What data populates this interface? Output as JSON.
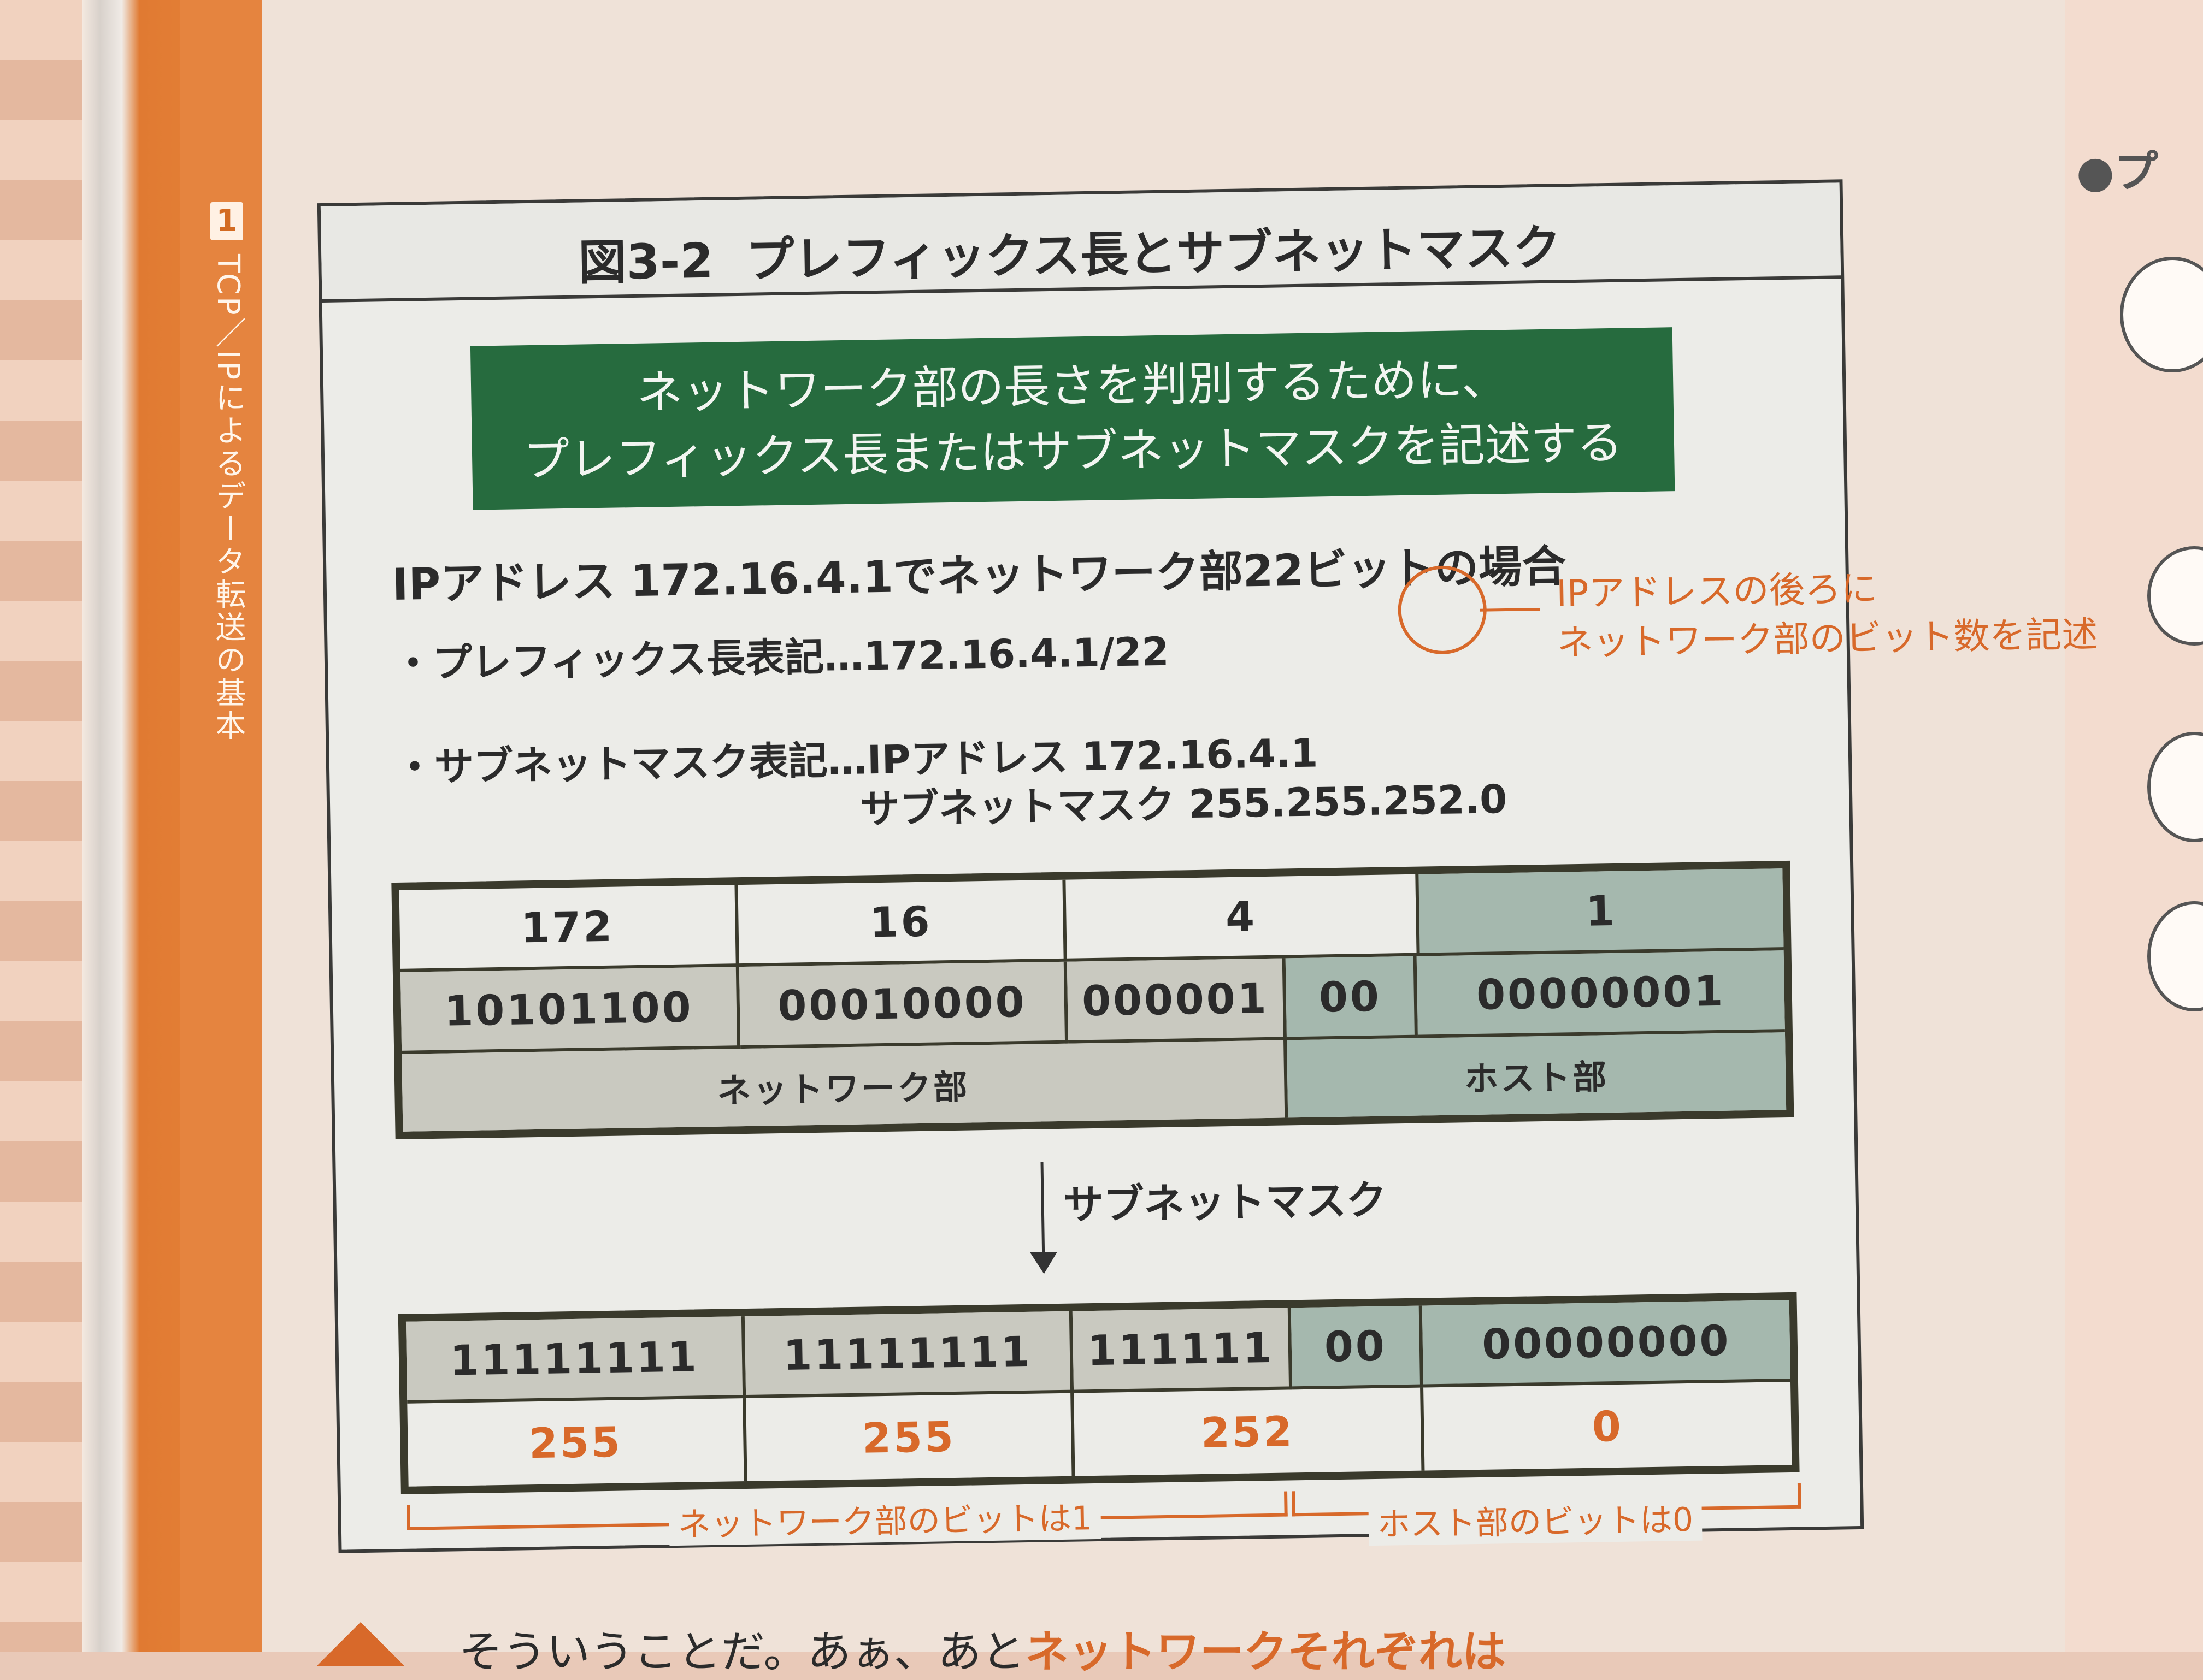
{
  "sidebar": {
    "chapter_number": "1",
    "chapter_title": "TCP／IPによるデータ転送の基本"
  },
  "right_page": {
    "heading": "●プ"
  },
  "figure": {
    "number": "図3-2",
    "title": "プレフィックス長とサブネットマスク",
    "banner_line1": "ネットワーク部の長さを判別するために、",
    "banner_line2": "プレフィックス長またはサブネットマスクを記述する",
    "case_text": "IPアドレス 172.16.4.1でネットワーク部22ビットの場合",
    "prefix_label": "・プレフィックス長表記…172.16.4.1/22",
    "prefix_note_line1": "IPアドレスの後ろに",
    "prefix_note_line2": "ネットワーク部のビット数を記述",
    "subnet_label": "・サブネットマスク表記…IPアドレス 172.16.4.1",
    "subnet_label2": "サブネットマスク 255.255.252.0",
    "table1": {
      "octets": [
        "172",
        "16",
        "4",
        "1"
      ],
      "bits": [
        "10101100",
        "00010000",
        "000001",
        "00",
        "00000001"
      ],
      "network_label": "ネットワーク部",
      "host_label": "ホスト部"
    },
    "arrow_label": "サブネットマスク",
    "table2": {
      "bits": [
        "11111111",
        "11111111",
        "111111",
        "00",
        "00000000"
      ],
      "octets": [
        "255",
        "255",
        "252",
        "0"
      ]
    },
    "network_bits_label": "ネットワーク部のビットは1",
    "host_bits_label": "ホスト部のビットは0",
    "colors": {
      "banner": "#266b3e",
      "accent": "#d8692a",
      "network_fill": "#c9c9c0",
      "host_fill": "#a5b8ae"
    }
  },
  "bottom": {
    "text_prefix": "そういうことだ。あぁ、あと",
    "text_highlight": "ネットワークそれぞれは"
  }
}
